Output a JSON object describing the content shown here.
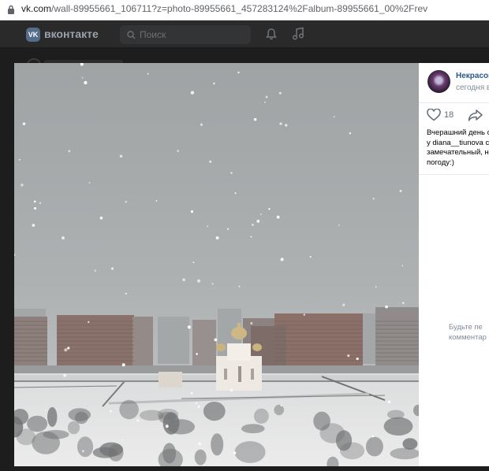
{
  "browser": {
    "url_host": "vk.com",
    "url_path": "/wall-89955661_106711?z=photo-89955661_457283124%2Falbum-89955661_00%2Frev"
  },
  "header": {
    "logo_text": "VK",
    "brand": "вконтакте",
    "search_placeholder": "Поиск"
  },
  "post": {
    "author": "Некрасовка",
    "time": "сегодня в",
    "likes": "18",
    "caption_lines": [
      "Вчерашний день с",
      "у diana__tiunova ск",
      "замечательный, н",
      "погоду:)"
    ]
  },
  "comments": {
    "empty_line1": "Будьте пе",
    "empty_line2": "комментар"
  },
  "colors": {
    "vk_header": "#2a2a2a",
    "link": "#2a5885",
    "muted": "#818c99",
    "sky": "#a9acad"
  },
  "icons": [
    "lock-icon",
    "search-icon",
    "bell-icon",
    "music-icon",
    "heart-icon",
    "share-icon"
  ]
}
